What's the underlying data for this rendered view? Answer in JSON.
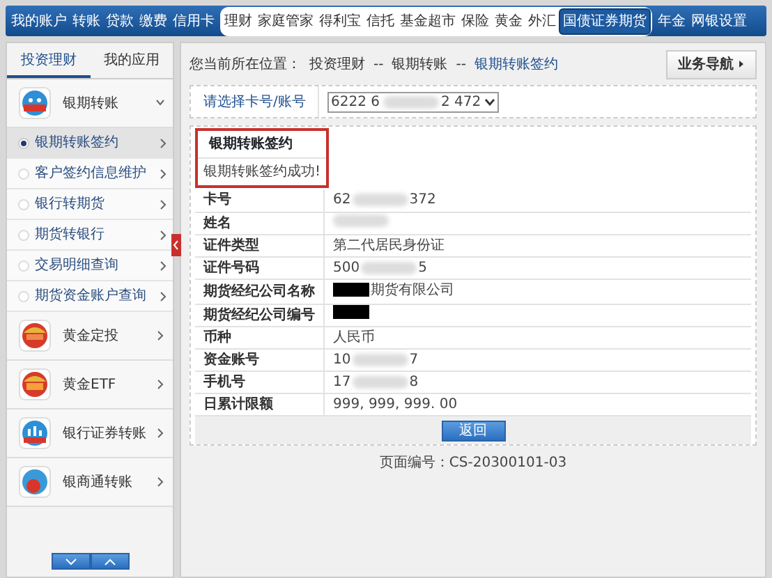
{
  "top_nav": {
    "left": [
      {
        "label": "我的账户"
      },
      {
        "label": "转账"
      },
      {
        "label": "贷款"
      },
      {
        "label": "缴费"
      },
      {
        "label": "信用卡"
      }
    ],
    "middle": [
      {
        "label": "理财",
        "selected": false
      },
      {
        "label": "家庭管家",
        "selected": false
      },
      {
        "label": "得利宝",
        "selected": false
      },
      {
        "label": "信托",
        "selected": false
      },
      {
        "label": "基金超市",
        "selected": false
      },
      {
        "label": "保险",
        "selected": false
      },
      {
        "label": "黄金",
        "selected": false
      },
      {
        "label": "外汇",
        "selected": false
      },
      {
        "label": "国债证券期货",
        "selected": true
      }
    ],
    "right": [
      {
        "label": "年金"
      },
      {
        "label": "网银设置"
      }
    ]
  },
  "sidebar": {
    "tabs": [
      {
        "label": "投资理财",
        "selected": true
      },
      {
        "label": "我的应用",
        "selected": false
      }
    ],
    "items": [
      {
        "label": "银期转账",
        "expanded": true,
        "children": [
          {
            "label": "银期转账签约",
            "selected": true
          },
          {
            "label": "客户签约信息维护",
            "selected": false
          },
          {
            "label": "银行转期货",
            "selected": false
          },
          {
            "label": "期货转银行",
            "selected": false
          },
          {
            "label": "交易明细查询",
            "selected": false
          },
          {
            "label": "期货资金账户查询",
            "selected": false
          }
        ]
      },
      {
        "label": "黄金定投",
        "expanded": false
      },
      {
        "label": "黄金ETF",
        "expanded": false
      },
      {
        "label": "银行证券转账",
        "expanded": false
      },
      {
        "label": "银商通转账",
        "expanded": false
      }
    ]
  },
  "breadcrumb": {
    "prefix": "您当前所在位置：",
    "path": [
      "投资理财",
      "银期转账",
      "银期转账签约"
    ],
    "separator": "--"
  },
  "nav_button": "业务导航",
  "account_select": {
    "label": "请选择卡号/账号",
    "value": [
      {
        "kind": "text",
        "text": "6222 6"
      },
      {
        "kind": "blur"
      },
      {
        "kind": "text",
        "text": "2 472"
      }
    ]
  },
  "result": {
    "title": "银期转账签约",
    "message": "银期转账签约成功!"
  },
  "details": [
    {
      "label": "卡号",
      "value": [
        {
          "kind": "text",
          "text": "62"
        },
        {
          "kind": "blur"
        },
        {
          "kind": "text",
          "text": "372"
        }
      ]
    },
    {
      "label": "姓名",
      "value": [
        {
          "kind": "blur"
        }
      ]
    },
    {
      "label": "证件类型",
      "value": [
        {
          "kind": "text",
          "text": "第二代居民身份证"
        }
      ]
    },
    {
      "label": "证件号码",
      "value": [
        {
          "kind": "text",
          "text": "500"
        },
        {
          "kind": "blur"
        },
        {
          "kind": "text",
          "text": "5"
        }
      ]
    },
    {
      "label": "期货经纪公司名称",
      "value": [
        {
          "kind": "redact"
        },
        {
          "kind": "text",
          "text": "期货有限公司"
        }
      ]
    },
    {
      "label": "期货经纪公司编号",
      "value": [
        {
          "kind": "redact"
        }
      ]
    },
    {
      "label": "币种",
      "value": [
        {
          "kind": "text",
          "text": "人民币"
        }
      ]
    },
    {
      "label": "资金账号",
      "value": [
        {
          "kind": "text",
          "text": "10"
        },
        {
          "kind": "blur"
        },
        {
          "kind": "text",
          "text": "7"
        }
      ]
    },
    {
      "label": "手机号",
      "value": [
        {
          "kind": "text",
          "text": "17"
        },
        {
          "kind": "blur"
        },
        {
          "kind": "text",
          "text": "8"
        }
      ]
    },
    {
      "label": "日累计限额",
      "value": [
        {
          "kind": "text",
          "text": "999, 999, 999. 00"
        }
      ]
    }
  ],
  "return_button": "返回",
  "page_code": "页面编号：CS-20300101-03"
}
